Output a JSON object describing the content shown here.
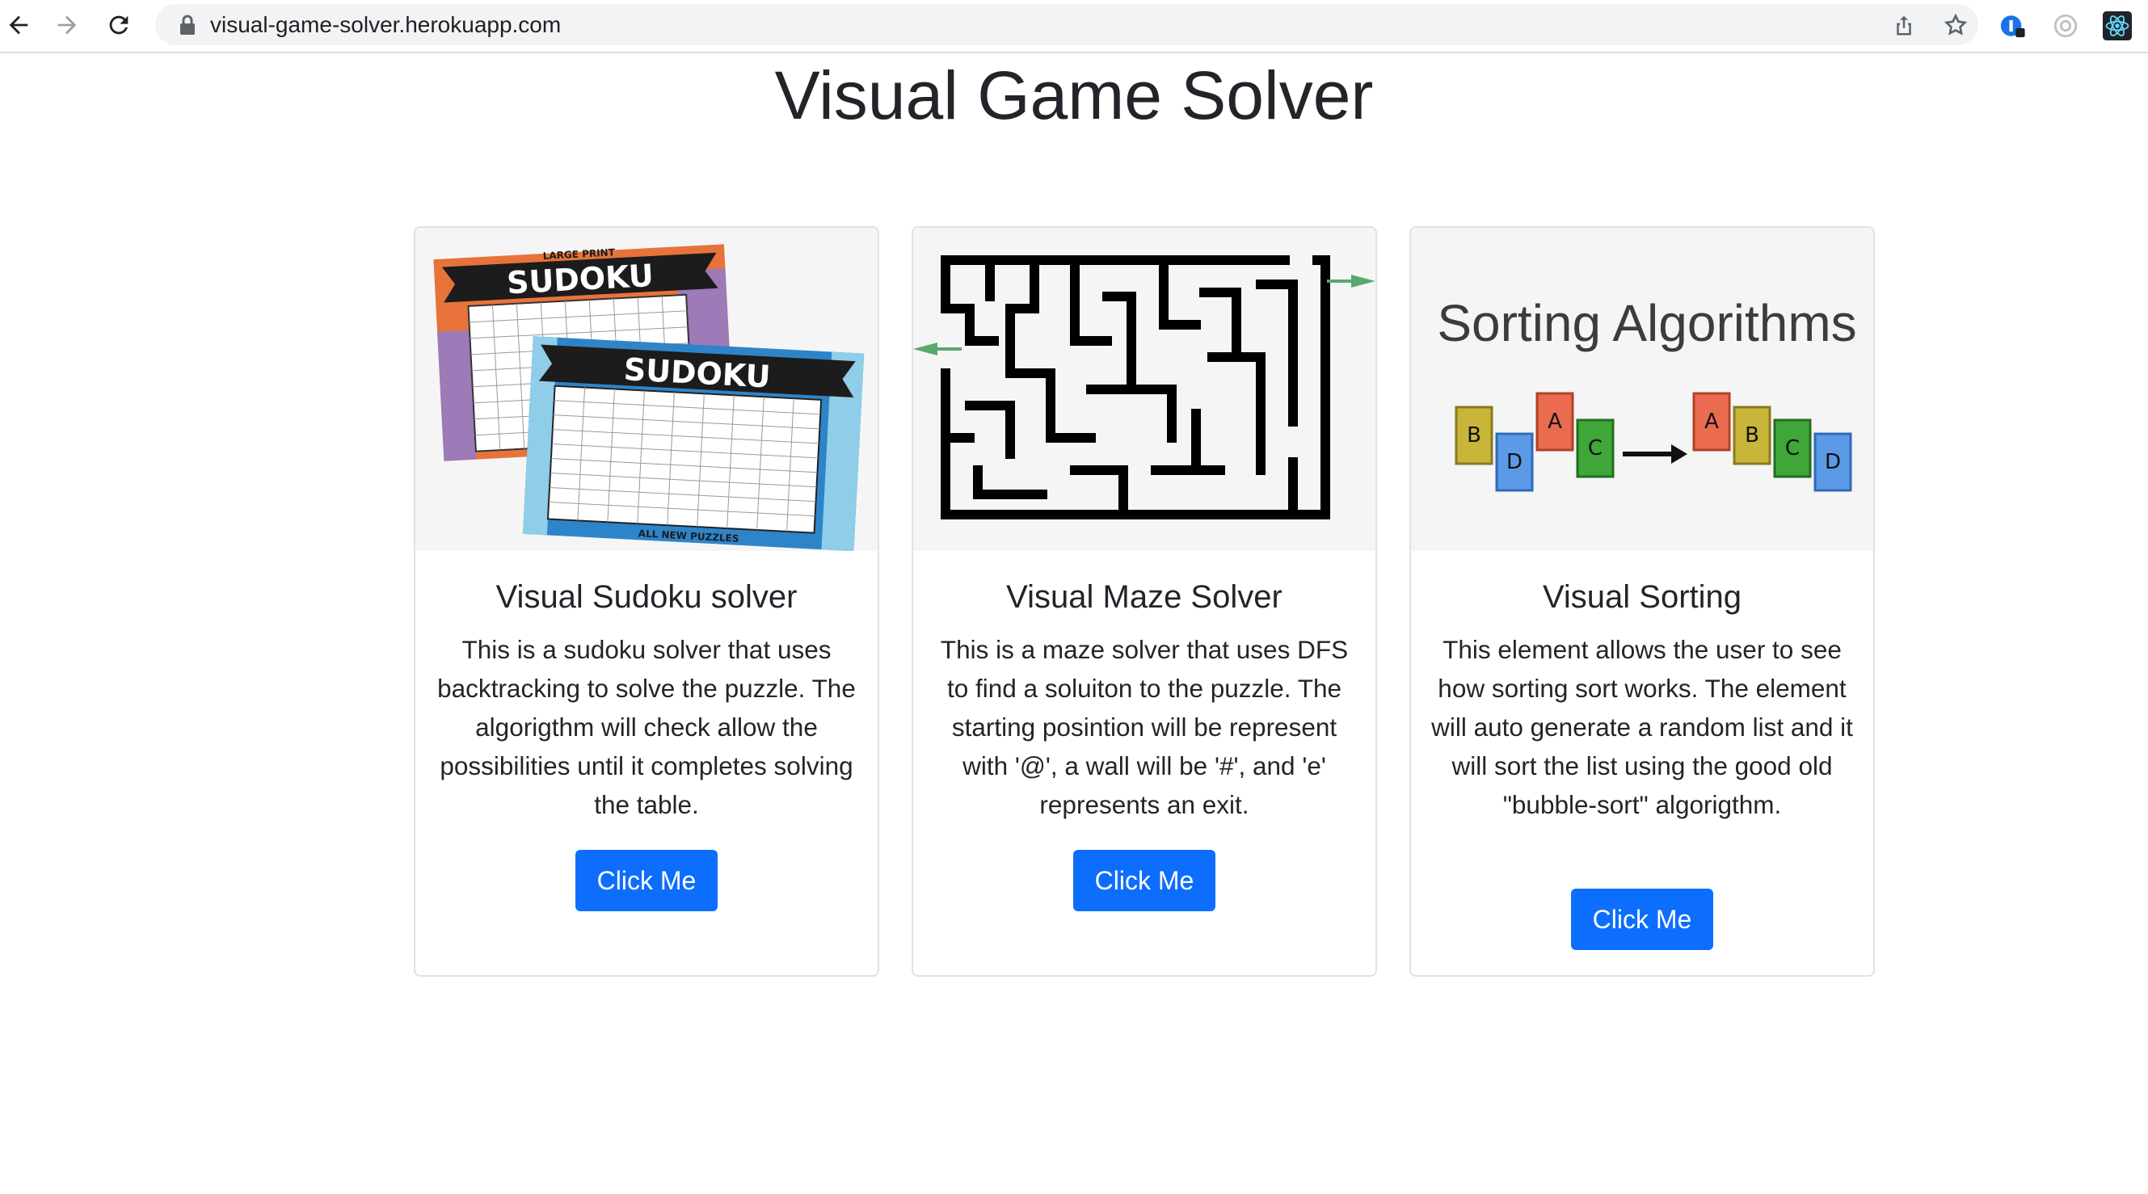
{
  "browser": {
    "url": "visual-game-solver.herokuapp.com",
    "nav_icons": [
      "back-icon",
      "forward-icon",
      "reload-icon"
    ],
    "omnibox_icons": [
      "lock-icon",
      "share-icon",
      "star-icon"
    ],
    "extension_icons": [
      "password-manager-icon",
      "extension-icon",
      "react-devtools-icon"
    ]
  },
  "page": {
    "title": "Visual Game Solver"
  },
  "cards": [
    {
      "image_caption_top": "LARGE PRINT",
      "image_word": "SUDOKU",
      "image_caption_bottom": "ALL NEW PUZZLES",
      "title": "Visual Sudoku solver",
      "text": "This is a sudoku solver that uses backtracking to solve the puzzle. The algorigthm will check allow the possibilities until it completes solving the table.",
      "button": "Click Me"
    },
    {
      "title": "Visual Maze Solver",
      "text": "This is a maze solver that uses DFS to find a soluiton to the puzzle. The starting posintion will be represent with '@', a wall will be '#', and 'e' represents an exit.",
      "button": "Click Me"
    },
    {
      "image_title": "Sorting Algorithms",
      "image_before": [
        "B",
        "D",
        "A",
        "C"
      ],
      "image_after": [
        "A",
        "B",
        "C",
        "D"
      ],
      "title": "Visual Sorting",
      "text": "This element allows the user to see how sorting sort works. The element will auto generate a random list and it will sort the list using the good old \"bubble-sort\" algorigthm.",
      "button": "Click Me"
    }
  ],
  "colors": {
    "primary_button": "#0d6efd",
    "card_border": "#dee2e6",
    "card_image_bg": "#f5f5f5"
  }
}
